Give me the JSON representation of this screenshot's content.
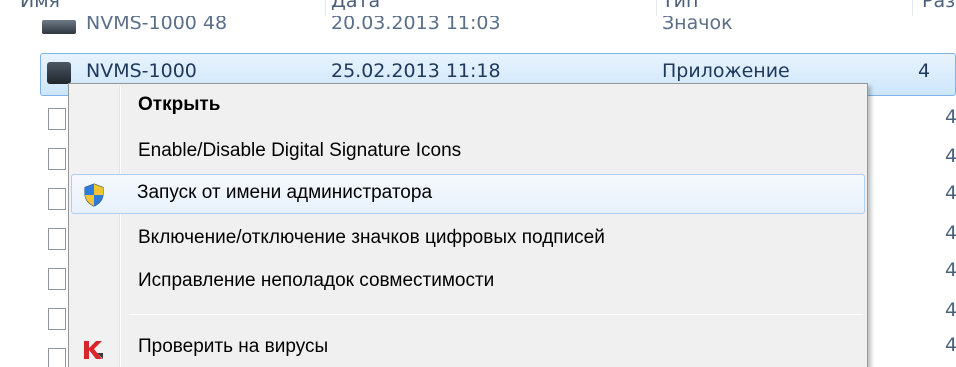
{
  "columns": {
    "name": "Имя",
    "date": "Дата",
    "type": "Тип",
    "size": "Разм"
  },
  "files": [
    {
      "name": "NVMS-1000 48",
      "date": "20.03.2013 11:03",
      "type": "Значок"
    },
    {
      "name": "NVMS-1000",
      "date": "25.02.2013 11:18",
      "type": "Приложение",
      "size": "4"
    }
  ],
  "side_sizes": [
    "4",
    "4",
    "4",
    "4",
    "4",
    "4",
    "4"
  ],
  "context_menu": {
    "items": [
      {
        "label": "Открыть",
        "bold": true,
        "icon": null
      },
      {
        "label": "Enable/Disable Digital Signature Icons",
        "icon": null
      },
      {
        "label": "Запуск от имени администратора",
        "icon": "uac-shield-icon",
        "highlighted": true
      },
      {
        "label": "Включение/отключение значков цифровых подписей",
        "icon": null
      },
      {
        "label": "Исправление неполадок совместимости",
        "icon": null
      },
      {
        "label": "Проверить на вирусы",
        "icon": "kaspersky-icon"
      }
    ]
  },
  "colors": {
    "selection_border": "#7eb4ea",
    "menu_hover_border": "#aecff7",
    "kaspersky_red": "#d8262b"
  }
}
